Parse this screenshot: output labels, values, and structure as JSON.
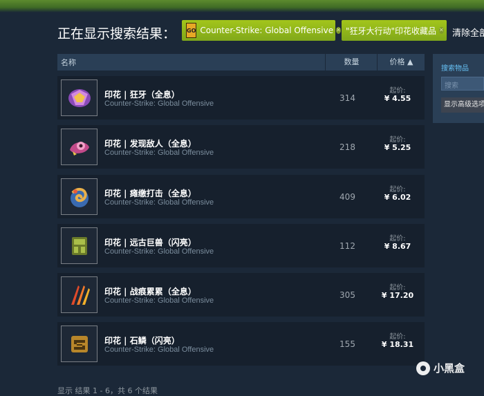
{
  "results": {
    "title": "正在显示搜索结果：",
    "tags": [
      {
        "logo": "GO",
        "label": "Counter-Strike: Global Offensive"
      },
      {
        "label": "\"狂牙大行动\"印花收藏品"
      }
    ],
    "clear_all": "清除全部"
  },
  "table": {
    "col_name": "名称",
    "col_qty": "数量",
    "col_price": "价格 ▲"
  },
  "items": [
    {
      "name": "印花 | 狂牙（全息）",
      "game": "Counter-Strike: Global Offensive",
      "qty": "314",
      "price_label": "起价:",
      "price": "¥ 4.55",
      "icon": "sticker-broken-fang-holo-icon",
      "color": "#c77bd6"
    },
    {
      "name": "印花 | 发现敌人（全息）",
      "game": "Counter-Strike: Global Offensive",
      "qty": "218",
      "price_label": "起价:",
      "price": "¥ 5.25",
      "icon": "sticker-enemy-spotted-holo-icon",
      "color": "#d25aa0"
    },
    {
      "name": "印花 | 瘫缴打击（全息）",
      "game": "Counter-Strike: Global Offensive",
      "qty": "409",
      "price_label": "起价:",
      "price": "¥ 6.02",
      "icon": "sticker-coiled-strike-holo-icon",
      "color": "#d6a04a"
    },
    {
      "name": "印花 | 远古巨兽（闪亮）",
      "game": "Counter-Strike: Global Offensive",
      "qty": "112",
      "price_label": "起价:",
      "price": "¥ 8.67",
      "icon": "sticker-ancient-beast-foil-icon",
      "color": "#8a9a3a"
    },
    {
      "name": "印花 | 战痕累累（全息）",
      "game": "Counter-Strike: Global Offensive",
      "qty": "305",
      "price_label": "起价:",
      "price": "¥ 17.20",
      "icon": "sticker-battle-scarred-holo-icon",
      "color": "#e06a2a"
    },
    {
      "name": "印花 | 石鳞（闪亮）",
      "game": "Counter-Strike: Global Offensive",
      "qty": "155",
      "price_label": "起价:",
      "price": "¥ 18.31",
      "icon": "sticker-stone-scales-foil-icon",
      "color": "#c89a3a"
    }
  ],
  "sidebar": {
    "label": "搜索物品",
    "search_placeholder": "搜索",
    "advanced": "显示高级选项"
  },
  "footer": {
    "text": "显示 结果 1 - 6，共 6 个结果"
  },
  "watermark": {
    "text": "小黑盒"
  },
  "colors": {
    "tag_bg": "#8fb21f",
    "page_bg": "#1b2838",
    "row_bg": "#16202d"
  }
}
